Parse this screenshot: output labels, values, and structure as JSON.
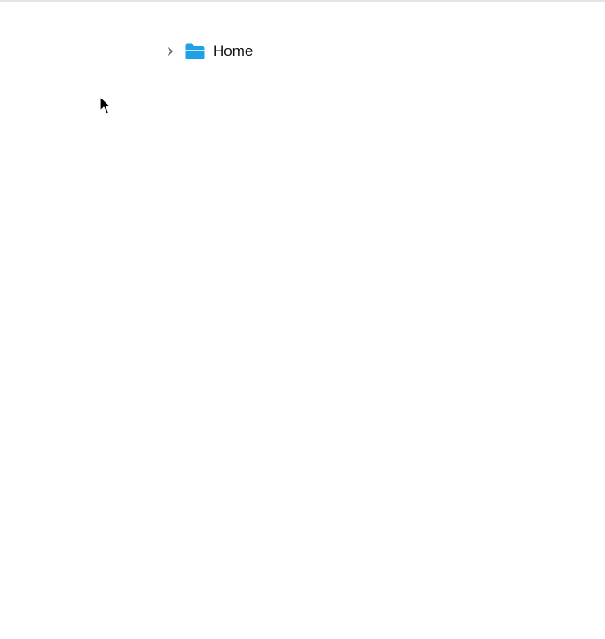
{
  "tree": {
    "items": [
      {
        "label": "Home",
        "expanded": false,
        "icon": "folder-icon",
        "chevron_icon": "chevron-right-icon",
        "icon_color": "#1ea1e6"
      }
    ]
  },
  "colors": {
    "background": "#ffffff",
    "top_border": "#e4e4e4",
    "chevron": "#666666",
    "text": "#111111"
  },
  "cursor": {
    "icon": "mouse-pointer-icon"
  }
}
